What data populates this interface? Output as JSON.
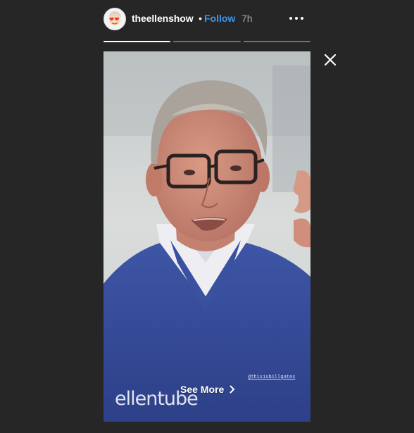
{
  "header": {
    "username": "theellenshow",
    "separator": "•",
    "follow_label": "Follow",
    "time": "7h",
    "more_icon": "ellipsis-horizontal-icon",
    "avatar_icon": "ellen-avatar"
  },
  "progress": {
    "segments": 3,
    "current_fill": 1.0,
    "current_index": 0
  },
  "close_icon": "close-icon",
  "media": {
    "handle": "@thisisbillgates",
    "watermark": "ellentube",
    "see_more_label": "See More",
    "see_more_icon": "chevron-right-icon"
  },
  "colors": {
    "background": "#262626",
    "follow_blue": "#3897f0",
    "sweater_blue": "#3a4f9c"
  }
}
